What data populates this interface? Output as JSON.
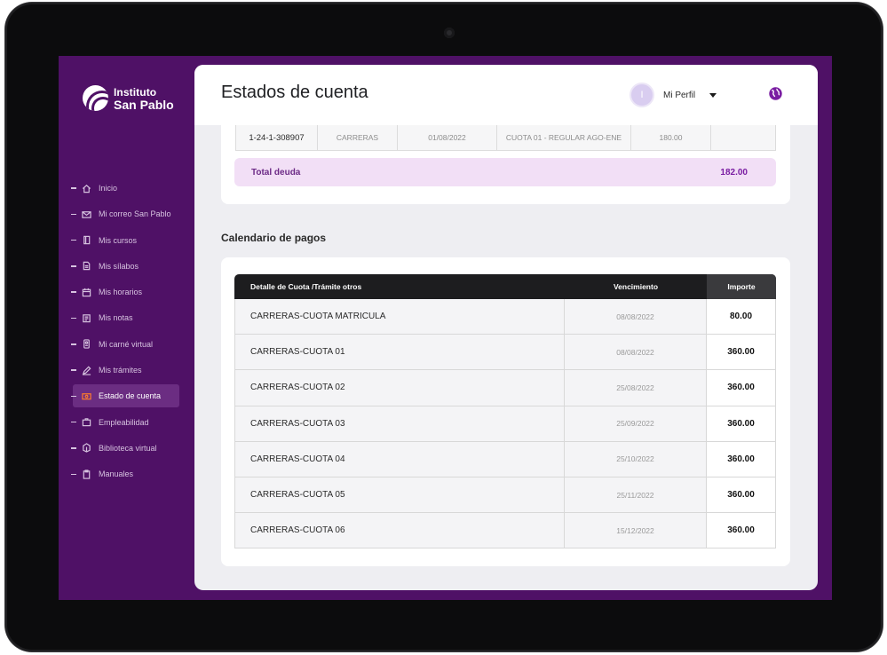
{
  "sidebar": {
    "logo_line1": "Instituto",
    "logo_line2": "San Pablo",
    "items": [
      {
        "label": "Inicio",
        "icon": "home-icon"
      },
      {
        "label": "Mi correo San Pablo",
        "icon": "mail-icon"
      },
      {
        "label": "Mis cursos",
        "icon": "book-icon"
      },
      {
        "label": "Mis sílabos",
        "icon": "document-icon"
      },
      {
        "label": "Mis horarios",
        "icon": "calendar-icon"
      },
      {
        "label": "Mis notas",
        "icon": "grades-icon"
      },
      {
        "label": "Mi carné virtual",
        "icon": "id-card-icon"
      },
      {
        "label": "Mis trámites",
        "icon": "pencil-icon"
      },
      {
        "label": "Estado de cuenta",
        "icon": "money-icon",
        "active": true
      },
      {
        "label": "Empleabilidad",
        "icon": "briefcase-icon"
      },
      {
        "label": "Biblioteca virtual",
        "icon": "library-icon"
      },
      {
        "label": "Manuales",
        "icon": "clipboard-icon"
      }
    ]
  },
  "header": {
    "title": "Estados de cuenta",
    "avatar_initial": "I",
    "profile_label": "Mi Perfil",
    "globe_icon": "globe-icon"
  },
  "debt": {
    "row": [
      "1-24-1-308907",
      "CARRERAS",
      "01/08/2022",
      "CUOTA 01 - REGULAR AGO-ENE",
      "180.00",
      ""
    ],
    "total_label": "Total deuda",
    "total_value": "182.00"
  },
  "calendar": {
    "title": "Calendario de pagos",
    "headers": {
      "detail": "Detalle de Cuota /Trámite otros",
      "due": "Vencimiento",
      "amount": "Importe"
    },
    "rows": [
      {
        "detail": "CARRERAS-CUOTA MATRICULA",
        "due": "08/08/2022",
        "amount": "80.00"
      },
      {
        "detail": "CARRERAS-CUOTA 01",
        "due": "08/08/2022",
        "amount": "360.00"
      },
      {
        "detail": "CARRERAS-CUOTA 02",
        "due": "25/08/2022",
        "amount": "360.00"
      },
      {
        "detail": "CARRERAS-CUOTA 03",
        "due": "25/09/2022",
        "amount": "360.00"
      },
      {
        "detail": "CARRERAS-CUOTA 04",
        "due": "25/10/2022",
        "amount": "360.00"
      },
      {
        "detail": "CARRERAS-CUOTA 05",
        "due": "25/11/2022",
        "amount": "360.00"
      },
      {
        "detail": "CARRERAS-CUOTA 06",
        "due": "15/12/2022",
        "amount": "360.00"
      }
    ]
  },
  "colors": {
    "sidebar_bg": "#4f1166",
    "accent_purple": "#7a1da2",
    "active_icon": "#ff7b2c",
    "table_header": "#1d1d1f"
  }
}
